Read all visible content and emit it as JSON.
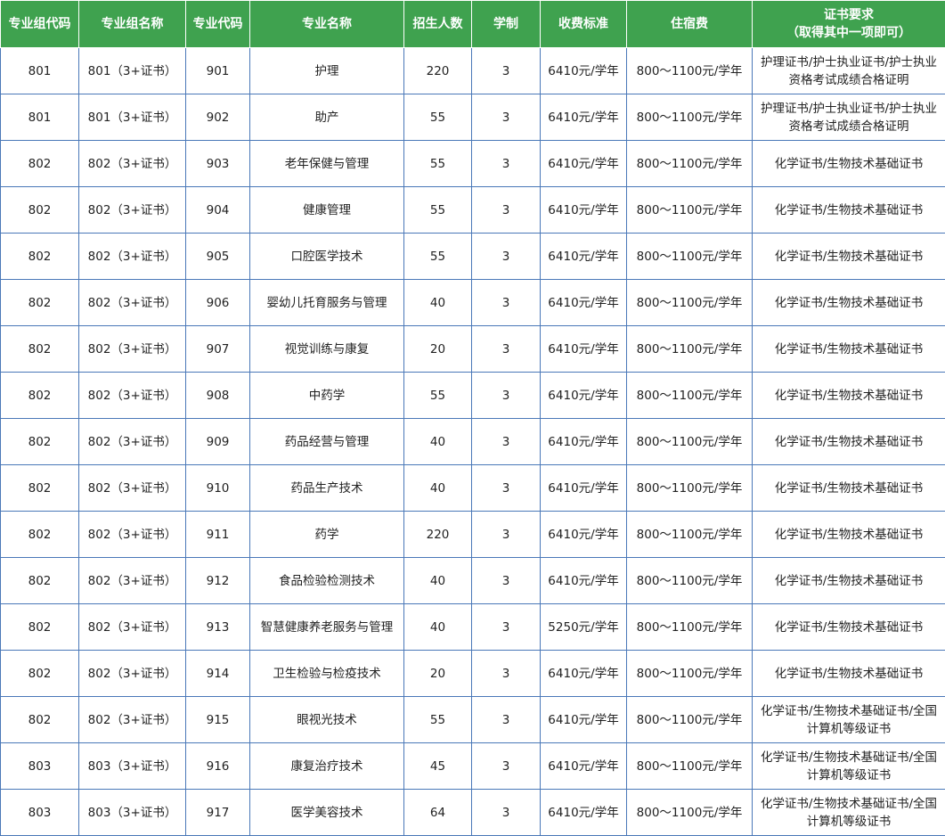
{
  "headers": {
    "group_code": "专业组代码",
    "group_name": "专业组名称",
    "major_code": "专业代码",
    "major_name": "专业名称",
    "enrollment": "招生人数",
    "duration": "学制",
    "tuition": "收费标准",
    "lodging": "住宿费",
    "cert_line1": "证书要求",
    "cert_line2": "（取得其中一项即可）"
  },
  "rows": [
    {
      "group_code": "801",
      "group_name": "801（3+证书）",
      "major_code": "901",
      "major_name": "护理",
      "enrollment": "220",
      "duration": "3",
      "tuition": "6410元/学年",
      "lodging": "800～1100元/学年",
      "cert": "护理证书/护士执业证书/护士执业资格考试成绩合格证明"
    },
    {
      "group_code": "801",
      "group_name": "801（3+证书）",
      "major_code": "902",
      "major_name": "助产",
      "enrollment": "55",
      "duration": "3",
      "tuition": "6410元/学年",
      "lodging": "800～1100元/学年",
      "cert": "护理证书/护士执业证书/护士执业资格考试成绩合格证明"
    },
    {
      "group_code": "802",
      "group_name": "802（3+证书）",
      "major_code": "903",
      "major_name": "老年保健与管理",
      "enrollment": "55",
      "duration": "3",
      "tuition": "6410元/学年",
      "lodging": "800～1100元/学年",
      "cert": "化学证书/生物技术基础证书"
    },
    {
      "group_code": "802",
      "group_name": "802（3+证书）",
      "major_code": "904",
      "major_name": "健康管理",
      "enrollment": "55",
      "duration": "3",
      "tuition": "6410元/学年",
      "lodging": "800～1100元/学年",
      "cert": "化学证书/生物技术基础证书"
    },
    {
      "group_code": "802",
      "group_name": "802（3+证书）",
      "major_code": "905",
      "major_name": "口腔医学技术",
      "enrollment": "55",
      "duration": "3",
      "tuition": "6410元/学年",
      "lodging": "800～1100元/学年",
      "cert": "化学证书/生物技术基础证书"
    },
    {
      "group_code": "802",
      "group_name": "802（3+证书）",
      "major_code": "906",
      "major_name": "婴幼儿托育服务与管理",
      "enrollment": "40",
      "duration": "3",
      "tuition": "6410元/学年",
      "lodging": "800～1100元/学年",
      "cert": "化学证书/生物技术基础证书"
    },
    {
      "group_code": "802",
      "group_name": "802（3+证书）",
      "major_code": "907",
      "major_name": "视觉训练与康复",
      "enrollment": "20",
      "duration": "3",
      "tuition": "6410元/学年",
      "lodging": "800～1100元/学年",
      "cert": "化学证书/生物技术基础证书"
    },
    {
      "group_code": "802",
      "group_name": "802（3+证书）",
      "major_code": "908",
      "major_name": "中药学",
      "enrollment": "55",
      "duration": "3",
      "tuition": "6410元/学年",
      "lodging": "800～1100元/学年",
      "cert": "化学证书/生物技术基础证书"
    },
    {
      "group_code": "802",
      "group_name": "802（3+证书）",
      "major_code": "909",
      "major_name": "药品经营与管理",
      "enrollment": "40",
      "duration": "3",
      "tuition": "6410元/学年",
      "lodging": "800～1100元/学年",
      "cert": "化学证书/生物技术基础证书"
    },
    {
      "group_code": "802",
      "group_name": "802（3+证书）",
      "major_code": "910",
      "major_name": "药品生产技术",
      "enrollment": "40",
      "duration": "3",
      "tuition": "6410元/学年",
      "lodging": "800～1100元/学年",
      "cert": "化学证书/生物技术基础证书"
    },
    {
      "group_code": "802",
      "group_name": "802（3+证书）",
      "major_code": "911",
      "major_name": "药学",
      "enrollment": "220",
      "duration": "3",
      "tuition": "6410元/学年",
      "lodging": "800～1100元/学年",
      "cert": "化学证书/生物技术基础证书"
    },
    {
      "group_code": "802",
      "group_name": "802（3+证书）",
      "major_code": "912",
      "major_name": "食品检验检测技术",
      "enrollment": "40",
      "duration": "3",
      "tuition": "6410元/学年",
      "lodging": "800～1100元/学年",
      "cert": "化学证书/生物技术基础证书"
    },
    {
      "group_code": "802",
      "group_name": "802（3+证书）",
      "major_code": "913",
      "major_name": "智慧健康养老服务与管理",
      "enrollment": "40",
      "duration": "3",
      "tuition": "5250元/学年",
      "lodging": "800～1100元/学年",
      "cert": "化学证书/生物技术基础证书"
    },
    {
      "group_code": "802",
      "group_name": "802（3+证书）",
      "major_code": "914",
      "major_name": "卫生检验与检疫技术",
      "enrollment": "20",
      "duration": "3",
      "tuition": "6410元/学年",
      "lodging": "800～1100元/学年",
      "cert": "化学证书/生物技术基础证书"
    },
    {
      "group_code": "802",
      "group_name": "802（3+证书）",
      "major_code": "915",
      "major_name": "眼视光技术",
      "enrollment": "55",
      "duration": "3",
      "tuition": "6410元/学年",
      "lodging": "800～1100元/学年",
      "cert": "化学证书/生物技术基础证书/全国计算机等级证书"
    },
    {
      "group_code": "803",
      "group_name": "803（3+证书）",
      "major_code": "916",
      "major_name": "康复治疗技术",
      "enrollment": "45",
      "duration": "3",
      "tuition": "6410元/学年",
      "lodging": "800～1100元/学年",
      "cert": "化学证书/生物技术基础证书/全国计算机等级证书"
    },
    {
      "group_code": "803",
      "group_name": "803（3+证书）",
      "major_code": "917",
      "major_name": "医学美容技术",
      "enrollment": "64",
      "duration": "3",
      "tuition": "6410元/学年",
      "lodging": "800～1100元/学年",
      "cert": "化学证书/生物技术基础证书/全国计算机等级证书"
    }
  ]
}
